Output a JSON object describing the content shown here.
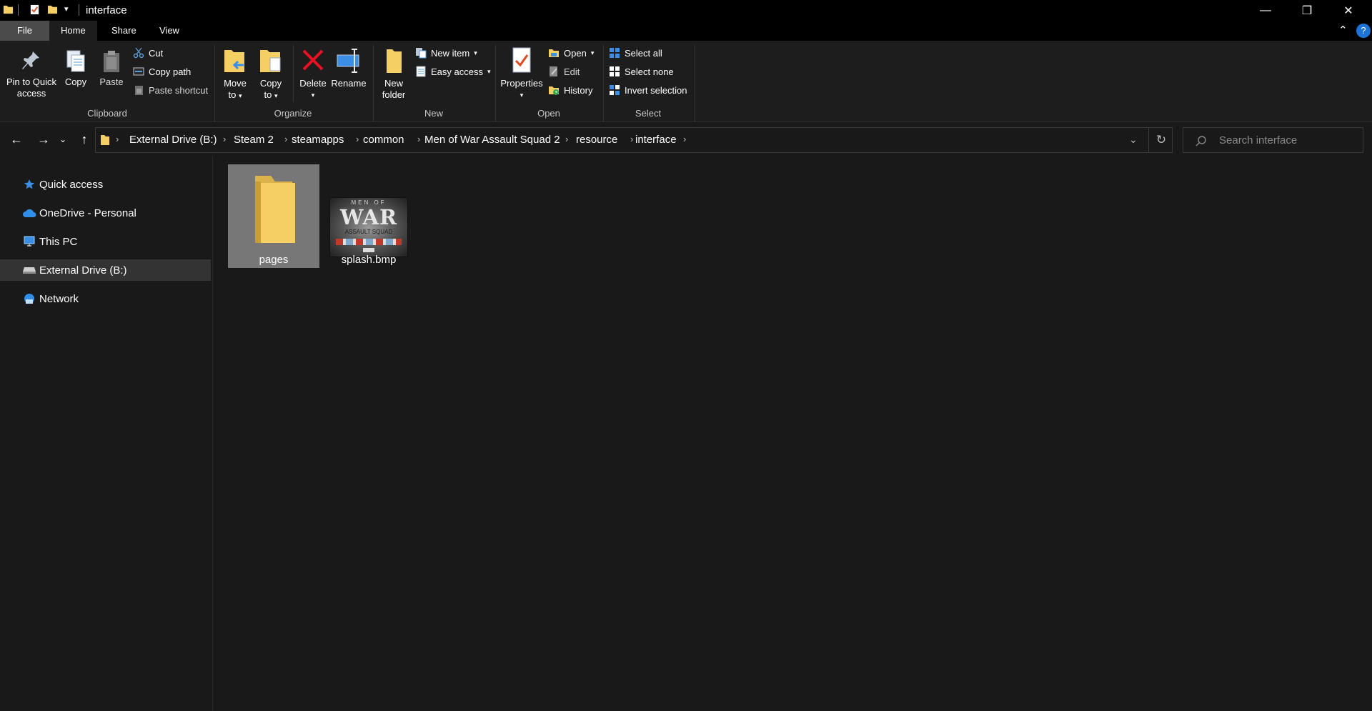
{
  "window": {
    "title": "interface",
    "minimize_glyph": "—",
    "restore_glyph": "❐",
    "close_glyph": "✕"
  },
  "ribbon_tabs": [
    {
      "label": "File"
    },
    {
      "label": "Home"
    },
    {
      "label": "Share"
    },
    {
      "label": "View"
    }
  ],
  "clipboard": {
    "pin_line1": "Pin to Quick",
    "pin_line2": "access",
    "copy": "Copy",
    "paste": "Paste",
    "cut": "Cut",
    "copy_path": "Copy path",
    "paste_shortcut": "Paste shortcut",
    "group_label": "Clipboard"
  },
  "organize": {
    "move_line1": "Move",
    "move_line2": "to",
    "copy_line1": "Copy",
    "copy_line2": "to",
    "delete": "Delete",
    "rename": "Rename",
    "group_label": "Organize"
  },
  "new_group": {
    "new_folder_line1": "New",
    "new_folder_line2": "folder",
    "new_item": "New item",
    "easy_access": "Easy access",
    "group_label": "New"
  },
  "open_group": {
    "properties": "Properties",
    "open": "Open",
    "edit": "Edit",
    "history": "History",
    "group_label": "Open"
  },
  "select_group": {
    "select_all": "Select all",
    "select_none": "Select none",
    "invert_selection": "Invert selection",
    "group_label": "Select"
  },
  "address": {
    "crumbs": [
      "External Drive (B:)",
      "Steam 2",
      "steamapps",
      "common",
      "Men of War Assault Squad 2",
      "resource",
      "interface"
    ]
  },
  "search": {
    "placeholder": "Search interface"
  },
  "nav_pane": {
    "items": [
      {
        "label": "Quick access",
        "icon": "star-icon"
      },
      {
        "label": "OneDrive - Personal",
        "icon": "cloud-icon"
      },
      {
        "label": "This PC",
        "icon": "computer-icon"
      },
      {
        "label": "External Drive (B:)",
        "icon": "drive-icon",
        "selected": true
      },
      {
        "label": "Network",
        "icon": "network-icon"
      }
    ]
  },
  "files": [
    {
      "name": "pages",
      "type": "folder",
      "selected": true
    },
    {
      "name": "splash.bmp",
      "type": "image",
      "thumb_line1": "MEN OF",
      "thumb_line2": "WAR",
      "thumb_line3": "ASSAULT SQUAD"
    }
  ],
  "colors": {
    "background": "#191919",
    "titlebar": "#000000",
    "ribbon": "#1d1d1d",
    "selection": "#777777",
    "nav_selection": "#333333",
    "folder_yellow": "#f5cf63",
    "delete_red": "#e81123",
    "accent_blue": "#3a8ee6"
  }
}
